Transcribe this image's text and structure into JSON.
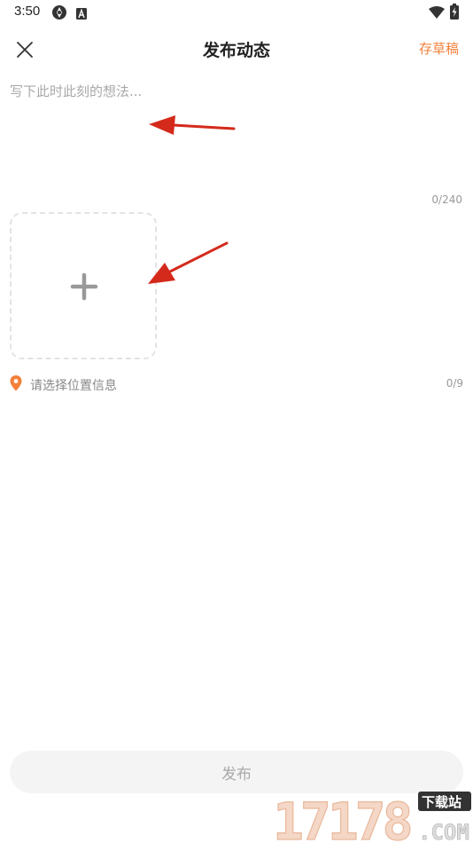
{
  "status_bar": {
    "time": "3:50",
    "icons": [
      "sync-icon",
      "a-badge-icon",
      "wifi-icon",
      "battery-charging-icon"
    ]
  },
  "header": {
    "title": "发布动态",
    "draft_label": "存草稿",
    "close_icon": "close-icon"
  },
  "composer": {
    "placeholder": "写下此时此刻的想法...",
    "value": "",
    "char_count": "0/240"
  },
  "media": {
    "add_icon": "plus-icon"
  },
  "location": {
    "label": "请选择位置信息",
    "count": "0/9",
    "icon": "location-pin-icon"
  },
  "footer": {
    "publish_label": "发布"
  },
  "watermark": {
    "site": "17178",
    "tag": "下载站",
    "domain": ".COM"
  },
  "colors": {
    "accent": "#f2803a",
    "arrow": "#d42a1c",
    "button_bg": "#f4f4f4",
    "button_text": "#a9a9a9"
  }
}
